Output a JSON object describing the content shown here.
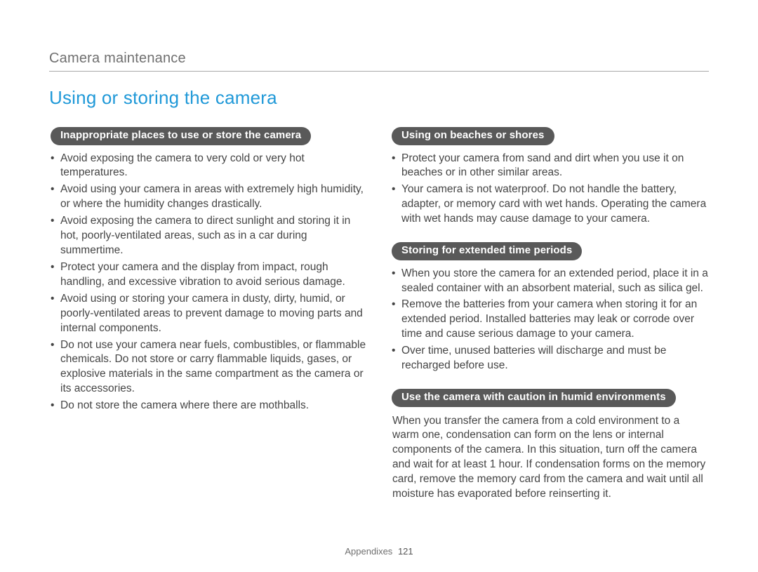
{
  "chapter": "Camera maintenance",
  "title": "Using or storing the camera",
  "left": {
    "sections": [
      {
        "heading": "Inappropriate places to use or store the camera",
        "bullets": [
          "Avoid exposing the camera to very cold or very hot temperatures.",
          "Avoid using your camera in areas with extremely high humidity, or where the humidity changes drastically.",
          "Avoid exposing the camera to direct sunlight and storing it in hot, poorly-ventilated areas, such as in a car during summertime.",
          "Protect your camera and the display from impact, rough handling, and excessive vibration to avoid serious damage.",
          "Avoid using or storing your camera in dusty, dirty, humid, or poorly-ventilated areas to prevent damage to moving parts and internal components.",
          "Do not use your camera near fuels, combustibles, or flammable chemicals. Do not store or carry flammable liquids, gases, or explosive materials in the same compartment as the camera or its accessories.",
          "Do not store the camera where there are mothballs."
        ]
      }
    ]
  },
  "right": {
    "sections": [
      {
        "heading": "Using on beaches or shores",
        "bullets": [
          "Protect your camera from sand and dirt when you use it on beaches or in other similar areas.",
          "Your camera is not waterproof. Do not handle the battery, adapter, or memory card with wet hands. Operating the camera with wet hands may cause damage to your camera."
        ]
      },
      {
        "heading": "Storing for extended time periods",
        "bullets": [
          "When you store the camera for an extended period, place it in a sealed container with an absorbent material, such as silica gel.",
          "Remove the batteries from your camera when storing it for an extended period. Installed batteries may leak or corrode over time and cause serious damage to your camera.",
          "Over time, unused batteries will discharge and must be recharged before use."
        ]
      },
      {
        "heading": "Use the camera with caution in humid environments",
        "paragraph": "When you transfer the camera from a cold environment to a warm one, condensation can form on the lens or internal components of the camera. In this situation, turn off the camera and wait for at least 1 hour. If condensation forms on the memory card, remove the memory card from the camera and wait until all moisture has evaporated before reinserting it."
      }
    ]
  },
  "footer": {
    "label": "Appendixes",
    "page": "121"
  }
}
